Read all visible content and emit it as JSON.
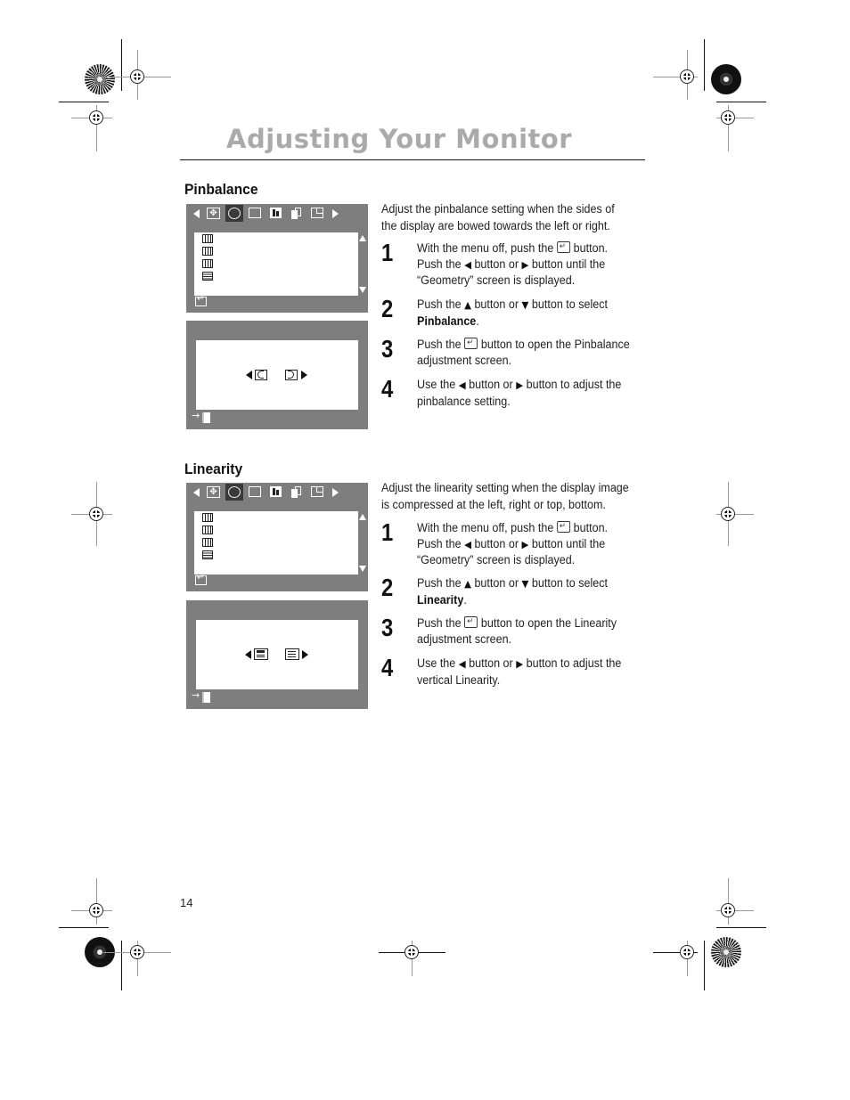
{
  "page": {
    "title": "Adjusting Your Monitor",
    "page_number": "14"
  },
  "sections": [
    {
      "title": "Pinbalance",
      "intro": "Adjust the pinbalance setting when the sides of the display are bowed towards the left or right.",
      "steps": [
        {
          "number": "1",
          "parts": [
            "With the menu off, push the",
            "button.",
            "Push the",
            "button or",
            "button until the",
            "“Geometry” screen is displayed."
          ]
        },
        {
          "number": "2",
          "parts": [
            "Push the",
            "button or",
            "button to select",
            "Pinbalance",
            "."
          ]
        },
        {
          "number": "3",
          "parts": [
            "Push the",
            "button to open the Pinbalance adjustment screen."
          ]
        },
        {
          "number": "4",
          "parts": [
            "Use the",
            "button or",
            "button to adjust the pinbalance setting."
          ]
        }
      ],
      "osd_menu": {
        "top_icons": [
          "left-arrow-icon",
          "position-icon",
          "geometry-icon",
          "size-icon",
          "color-icon",
          "advanced-icon",
          "osd-icon",
          "right-arrow-icon"
        ],
        "selected_icon": "geometry-icon",
        "list_icons": [
          "pincushion-icon",
          "trapezoid-icon",
          "pinbalance-icon",
          "linearity-icon"
        ]
      },
      "osd_adjust": {
        "left_icon": "pinbalance-left-icon",
        "right_icon": "pinbalance-right-icon"
      }
    },
    {
      "title": "Linearity",
      "intro": "Adjust the linearity setting when the display image is compressed at the left, right or top, bottom.",
      "steps": [
        {
          "number": "1",
          "parts": [
            "With the menu off, push the",
            "button.",
            "Push the",
            "button or",
            "button until the",
            "“Geometry” screen is displayed."
          ]
        },
        {
          "number": "2",
          "parts": [
            "Push the",
            "button or",
            "button to select",
            "Linearity",
            "."
          ]
        },
        {
          "number": "3",
          "parts": [
            "Push the",
            "button to open the Linearity adjustment screen."
          ]
        },
        {
          "number": "4",
          "parts": [
            "Use the",
            "button or",
            "button to adjust the vertical Linearity."
          ]
        }
      ],
      "osd_menu": {
        "top_icons": [
          "left-arrow-icon",
          "position-icon",
          "geometry-icon",
          "size-icon",
          "color-icon",
          "advanced-icon",
          "osd-icon",
          "right-arrow-icon"
        ],
        "selected_icon": "geometry-icon",
        "list_icons": [
          "pincushion-icon",
          "trapezoid-icon",
          "pinbalance-icon",
          "linearity-icon"
        ]
      },
      "osd_adjust": {
        "left_icon": "linearity-compress-icon",
        "right_icon": "linearity-expand-icon"
      }
    }
  ]
}
